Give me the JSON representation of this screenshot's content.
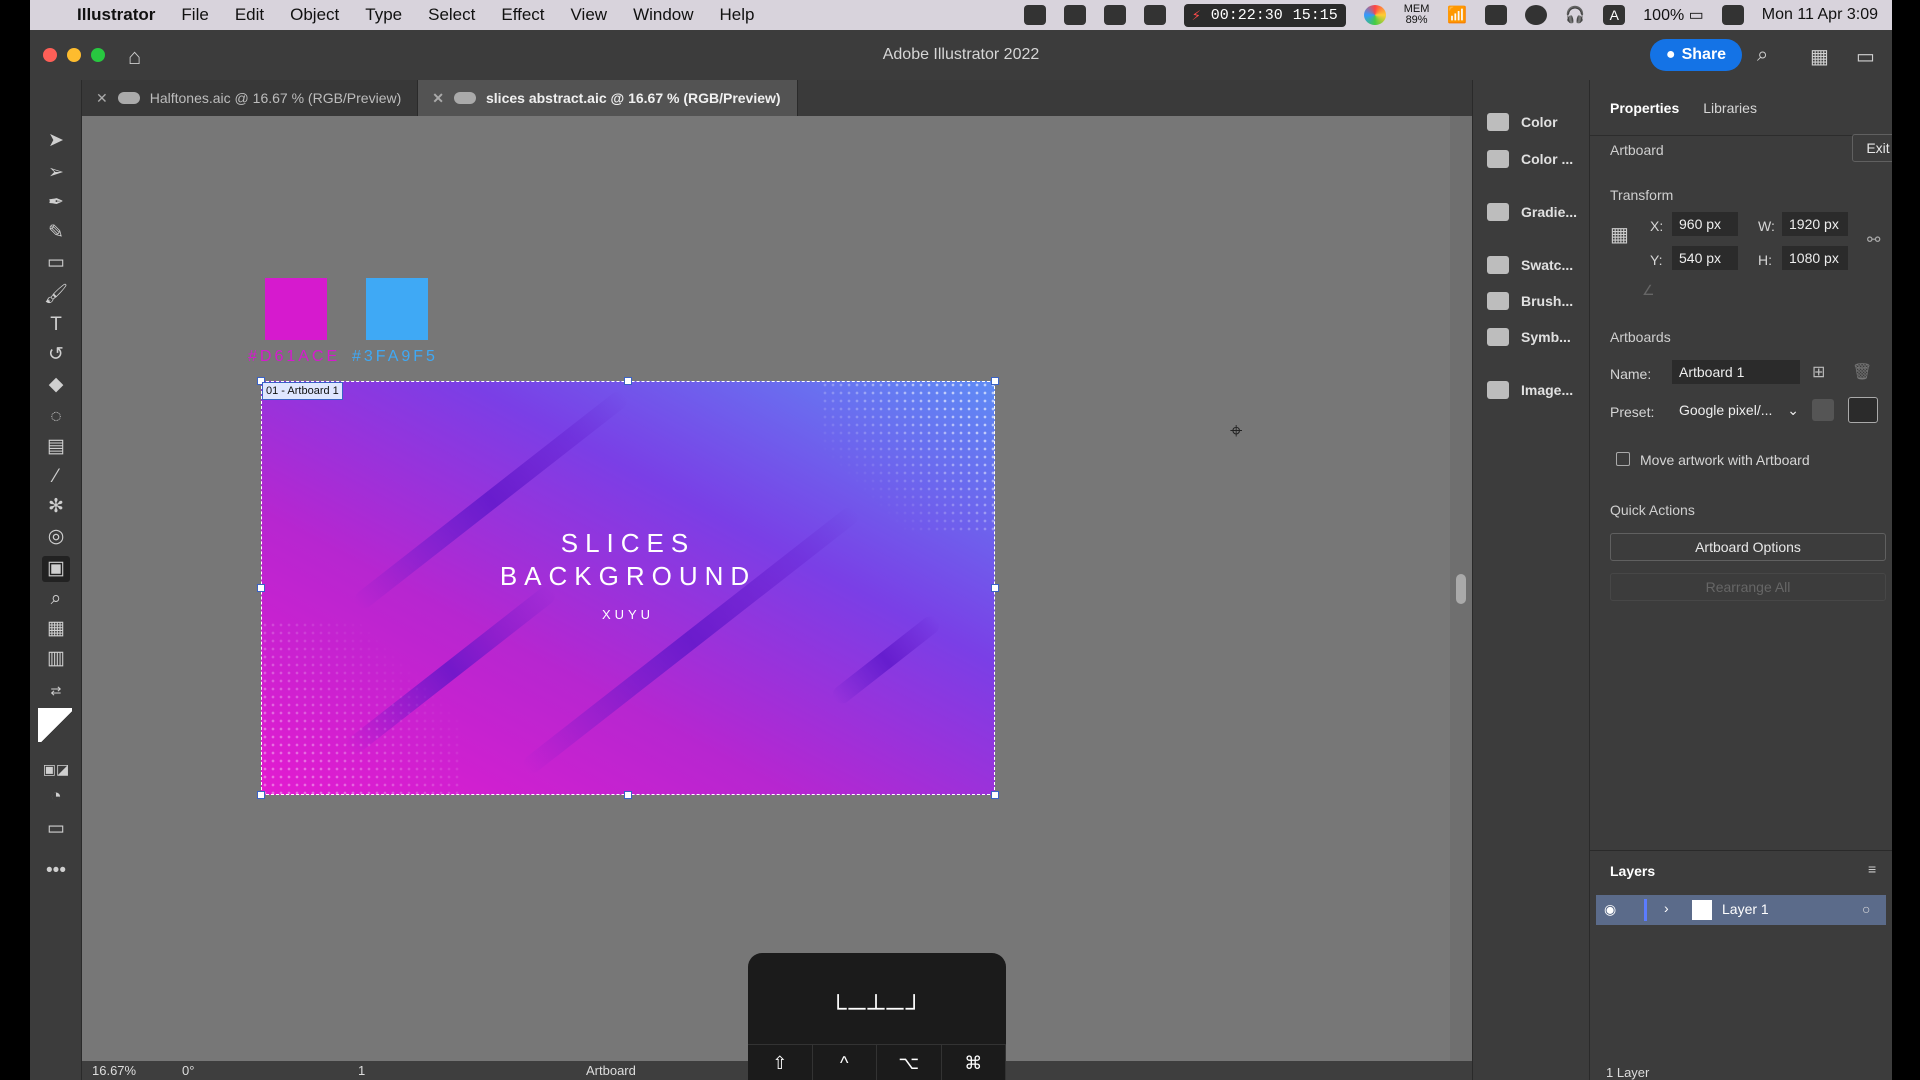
{
  "menubar": {
    "app": "Illustrator",
    "items": [
      "File",
      "Edit",
      "Object",
      "Type",
      "Select",
      "Effect",
      "View",
      "Window",
      "Help"
    ],
    "recording_time": "00:22:30",
    "recording_clock": "15:15",
    "mem_label": "MEM",
    "mem_value": "89%",
    "battery": "100%",
    "datetime": "Mon 11 Apr  3:09"
  },
  "window": {
    "title": "Adobe Illustrator 2022",
    "share_label": "Share"
  },
  "tabs": [
    {
      "label": "Halftones.aic @ 16.67 % (RGB/Preview)"
    },
    {
      "label": "slices abstract.aic @ 16.67 % (RGB/Preview)"
    }
  ],
  "canvas": {
    "swatch1_label": "#D61ACE",
    "swatch2_label": "#3FA9F5",
    "artboard_label": "01 - Artboard 1",
    "art_title_line1": "SLICES",
    "art_title_line2": "BACKGROUND",
    "art_subtitle": "XUYU"
  },
  "colors": {
    "swatch1": "#D61ACE",
    "swatch2": "#3FA9F5",
    "accent": "#1473E6"
  },
  "statusbar": {
    "zoom": "16.67%",
    "rotation": "0°",
    "artboard_number": "1",
    "mode": "Artboard"
  },
  "keycast": {
    "modifiers": [
      "⇧",
      "^",
      "⌥",
      "⌘"
    ]
  },
  "minidock": {
    "items": [
      "Color",
      "Color ...",
      "Gradie...",
      "Swatc...",
      "Brush...",
      "Symb...",
      "Image..."
    ]
  },
  "properties": {
    "tab_properties": "Properties",
    "tab_libraries": "Libraries",
    "artboard_label": "Artboard",
    "exit_label": "Exit",
    "transform_label": "Transform",
    "x_label": "X:",
    "x_value": "960 px",
    "y_label": "Y:",
    "y_value": "540 px",
    "w_label": "W:",
    "w_value": "1920 px",
    "h_label": "H:",
    "h_value": "1080 px",
    "artboards_label": "Artboards",
    "name_label": "Name:",
    "name_value": "Artboard 1",
    "preset_label": "Preset:",
    "preset_value": "Google pixel/...",
    "move_artwork_label": "Move artwork with Artboard",
    "quick_actions_label": "Quick Actions",
    "artboard_options_label": "Artboard Options",
    "rearrange_label": "Rearrange All"
  },
  "layers": {
    "title": "Layers",
    "layer_name": "Layer 1",
    "count": "1 Layer"
  }
}
